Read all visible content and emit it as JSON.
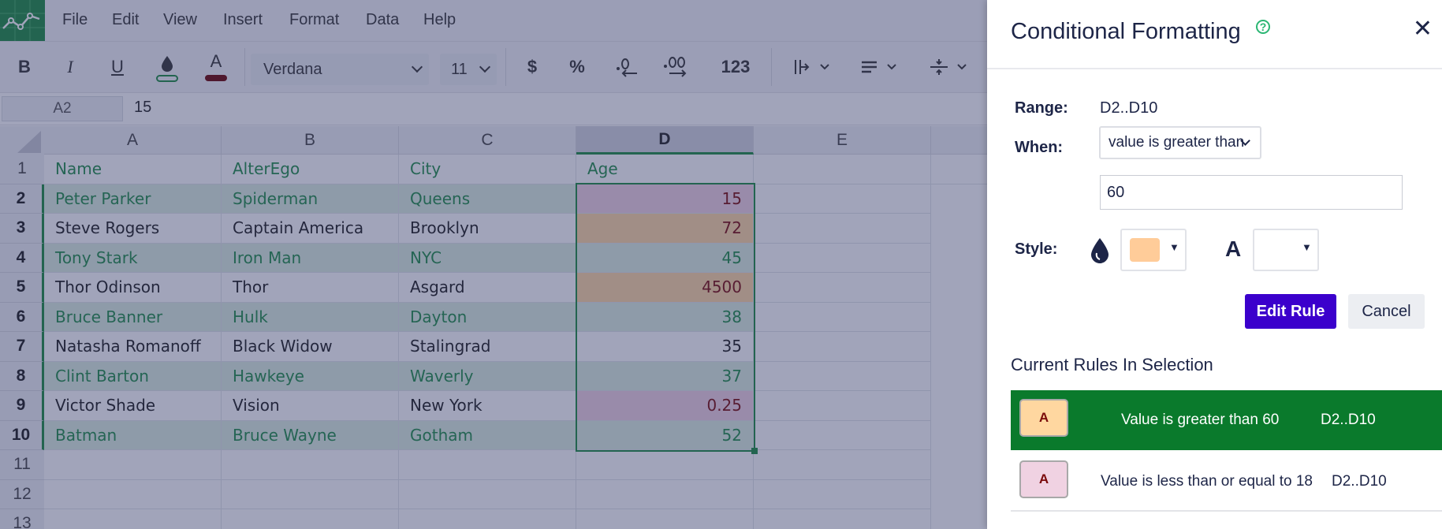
{
  "menubar": {
    "items": [
      "File",
      "Edit",
      "View",
      "Insert",
      "Format",
      "Data",
      "Help"
    ]
  },
  "toolbar": {
    "bold_label": "B",
    "italic_label": "I",
    "underline_label": "U",
    "text_color_label": "A",
    "font_family": "Verdana",
    "font_size": "11",
    "currency_label": "$",
    "percent_label": "%",
    "number_format_label": "123",
    "icons": [
      "paint-bucket-icon",
      "text-color-icon",
      "decrease-decimal-icon",
      "increase-decimal-icon",
      "vertical-align-icon",
      "horizontal-align-icon",
      "wrap-icon"
    ]
  },
  "formula_bar": {
    "cell_ref": "A2",
    "value": "15"
  },
  "sheet": {
    "columns": [
      "A",
      "B",
      "C",
      "D",
      "E"
    ],
    "selected_column": "D",
    "row_numbers": [
      "1",
      "2",
      "3",
      "4",
      "5",
      "6",
      "7",
      "8",
      "9",
      "10",
      "11",
      "12",
      "13"
    ],
    "rows": [
      [
        "Name",
        "AlterEgo",
        "City",
        "Age"
      ],
      [
        "Peter Parker",
        "Spiderman",
        "Queens",
        "15"
      ],
      [
        "Steve Rogers",
        "Captain America",
        "Brooklyn",
        "72"
      ],
      [
        "Tony Stark",
        "Iron Man",
        "NYC",
        "45"
      ],
      [
        "Thor Odinson",
        "Thor",
        "Asgard",
        "4500"
      ],
      [
        "Bruce Banner",
        "Hulk",
        "Dayton",
        "38"
      ],
      [
        "Natasha Romanoff",
        "Black Widow",
        "Stalingrad",
        "35"
      ],
      [
        "Clint Barton",
        "Hawkeye",
        "Waverly",
        "37"
      ],
      [
        "Victor Shade",
        "Vision",
        "New York",
        "0.25"
      ],
      [
        "Batman",
        "Bruce Wayne",
        "Gotham",
        "52"
      ]
    ],
    "highlight_colors": {
      "green_band": "#ddeee0",
      "green_text": "#1e8c45",
      "greater_than_fill": "#ffd7a0",
      "less_equal_fill": "#f0d2e2",
      "rule_text_color": "#7a0a0a"
    }
  },
  "panel": {
    "title": "Conditional Formatting",
    "help_icon": "?",
    "close_icon": "✕",
    "range_label": "Range:",
    "range_value": "D2..D10",
    "when_label": "When:",
    "when_value": "value is greater than",
    "value_input": "60",
    "style_label": "Style:",
    "fill_swatch_color": "#ffcc99",
    "text_swatch_color": "#6b0000",
    "text_style_label": "A",
    "edit_button": "Edit Rule",
    "cancel_button": "Cancel",
    "current_rules_title": "Current Rules In Selection",
    "rules": [
      {
        "badge": "A",
        "text": "Value is greater than 60",
        "range": "D2..D10",
        "fill": "#ffd7a0",
        "active": true
      },
      {
        "badge": "A",
        "text": "Value is less than or equal to 18",
        "range": "D2..D10",
        "fill": "#f0d2e2",
        "active": false
      }
    ]
  }
}
